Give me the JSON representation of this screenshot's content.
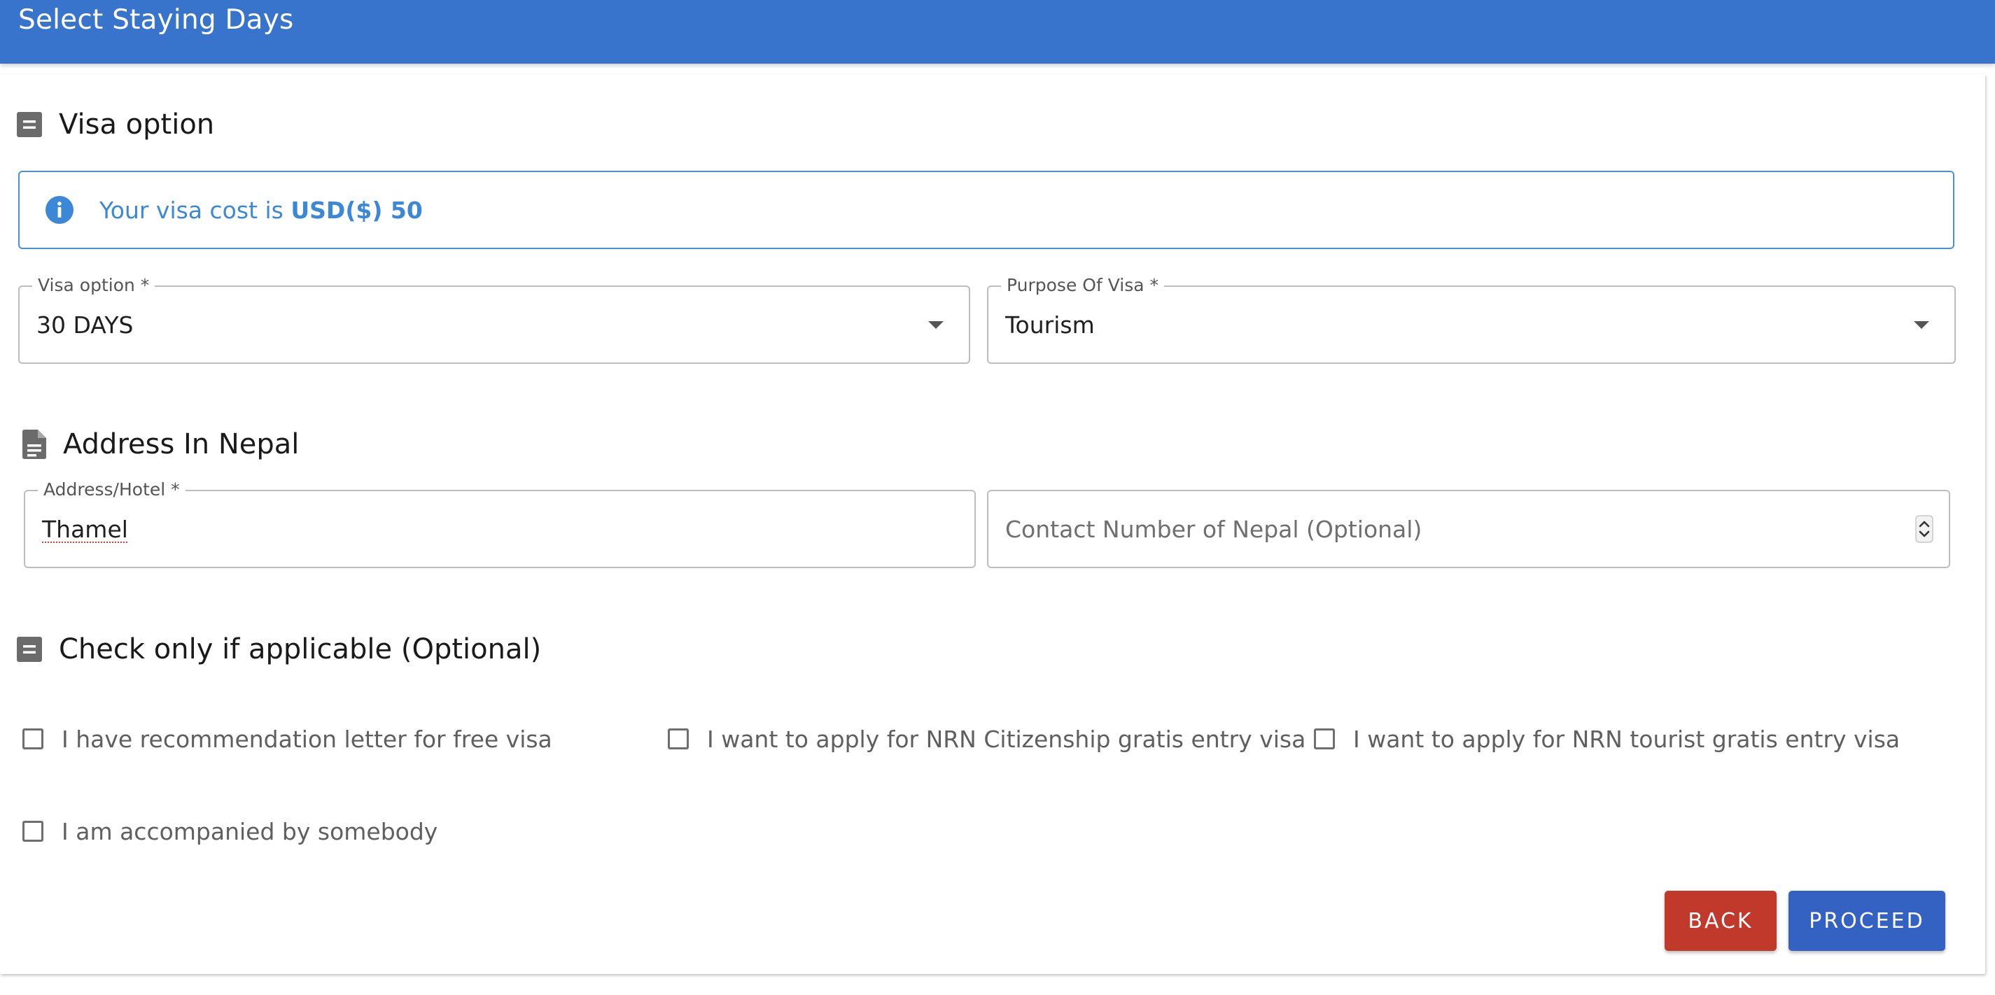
{
  "header": {
    "title": "Select Staying Days"
  },
  "visa_section": {
    "heading": "Visa option",
    "alert_prefix": "Your visa cost is",
    "alert_amount": "USD($) 50",
    "visa_option": {
      "label": "Visa option *",
      "value": "30 DAYS"
    },
    "purpose": {
      "label": "Purpose Of Visa *",
      "value": "Tourism"
    }
  },
  "address_section": {
    "heading": "Address In Nepal",
    "address": {
      "label": "Address/Hotel *",
      "value": "Thamel"
    },
    "contact": {
      "placeholder": "Contact Number of Nepal (Optional)"
    }
  },
  "checks_section": {
    "heading": "Check only if applicable (Optional)",
    "items": [
      "I have recommendation letter for free visa",
      "I want to apply for NRN Citizenship gratis entry visa",
      "I want to apply for NRN tourist gratis entry visa",
      "I am accompanied by somebody"
    ]
  },
  "actions": {
    "back": "Back",
    "proceed": "Proceed"
  },
  "colors": {
    "header": "#3874cb",
    "alert_border": "#4a8fd9",
    "alert_text": "#3d88d6",
    "back_button": "#c0392b",
    "proceed_button": "#3462c2"
  },
  "icons": {
    "visa_heading": "list-icon",
    "alert": "info-icon",
    "address_heading": "document-icon",
    "checks_heading": "list-icon"
  }
}
